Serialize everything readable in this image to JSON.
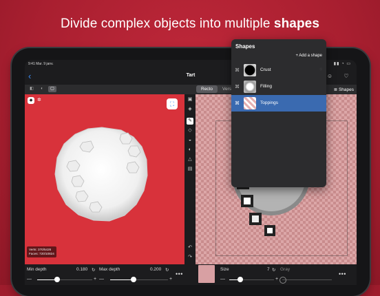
{
  "headline": {
    "normal": "Divide complex objects into multiple ",
    "bold": "shapes"
  },
  "status": {
    "time": "9:41 Mar. 9 janv.",
    "icons": "▮▮ ◔ ▭"
  },
  "nav": {
    "back_icon": "‹",
    "title": "Tart",
    "tools": [
      "▢",
      "⤓",
      "⇪",
      "☺",
      "♡"
    ]
  },
  "viewmodes": [
    "◧",
    "◐",
    "▢"
  ],
  "segment": {
    "left": "Recto",
    "right": "Verso"
  },
  "shapes_button": "Shapes",
  "left_pane": {
    "stats_verts": "Verts: 370/5426",
    "stats_faces": "Faces: 720/10824"
  },
  "shapes_panel": {
    "title": "Shapes",
    "add_label": "+  Add a shape",
    "items": [
      {
        "label": "Crust",
        "selected": false
      },
      {
        "label": "Filling",
        "selected": false
      },
      {
        "label": "Toppings",
        "selected": true
      }
    ]
  },
  "controls": {
    "min_depth": {
      "label": "Min depth",
      "value": "0.180",
      "level": 0.36
    },
    "max_depth": {
      "label": "Max depth",
      "value": "0.200",
      "level": 0.4
    },
    "size": {
      "label": "Size",
      "value": "7",
      "level": 0.25
    },
    "gray": {
      "label": "Gray",
      "level": 0.0
    }
  },
  "colors": {
    "accent": "#3b8cf5",
    "background": "#b0202f",
    "selected_row": "#3a6ab0"
  }
}
